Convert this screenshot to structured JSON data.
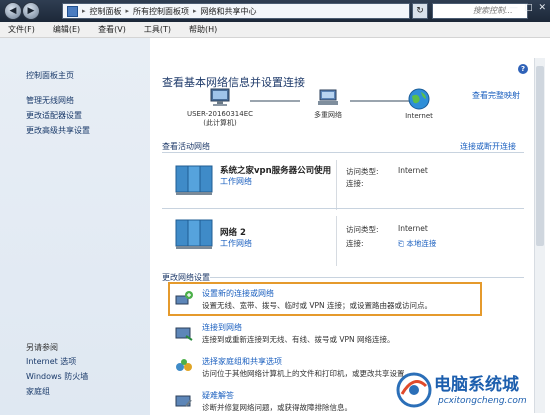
{
  "titlebar": {
    "back": "◀",
    "forward": "▶",
    "crumbs": [
      "控制面板",
      "所有控制面板项",
      "网络和共享中心"
    ],
    "refresh": "↻",
    "search_placeholder": "搜索控制...",
    "controls": [
      "—",
      "□",
      "✕"
    ]
  },
  "menu": [
    "文件(F)",
    "编辑(E)",
    "查看(V)",
    "工具(T)",
    "帮助(H)"
  ],
  "sidebar": {
    "home": "控制面板主页",
    "tasks": [
      "管理无线网络",
      "更改适配器设置",
      "更改高级共享设置"
    ],
    "see_also_title": "另请参阅",
    "see_also": [
      "Internet 选项",
      "Windows 防火墙",
      "家庭组"
    ]
  },
  "main": {
    "heading": "查看基本网络信息并设置连接",
    "full_map": "查看完整映射",
    "map_nodes": [
      {
        "label": "USER-20160314EC",
        "sub": "(此计算机)"
      },
      {
        "label": "多重网络",
        "sub": ""
      },
      {
        "label": "Internet",
        "sub": ""
      }
    ],
    "active_title": "查看活动网络",
    "connect_link": "连接或断开连接",
    "networks": [
      {
        "name": "系统之家vpn服务器公司使用",
        "type": "工作网络",
        "access_label": "访问类型:",
        "access_value": "Internet",
        "conn_label": "连接:",
        "conn_value": ""
      },
      {
        "name": "网络  2",
        "type": "工作网络",
        "access_label": "访问类型:",
        "access_value": "Internet",
        "conn_label": "连接:",
        "conn_value": "本地连接"
      }
    ],
    "change_title": "更改网络设置",
    "tasks": [
      {
        "title": "设置新的连接或网络",
        "desc": "设置无线、宽带、拨号、临时或 VPN 连接；或设置路由器或访问点。"
      },
      {
        "title": "连接到网络",
        "desc": "连接到或重新连接到无线、有线、拨号或 VPN 网络连接。"
      },
      {
        "title": "选择家庭组和共享选项",
        "desc": "访问位于其他网络计算机上的文件和打印机，或更改共享设置。"
      },
      {
        "title": "疑难解答",
        "desc": "诊断并修复网络问题，或获得故障排除信息。"
      }
    ]
  },
  "watermark": {
    "brand": "电脑系统城",
    "url": "pcxitongcheng.com"
  },
  "colors": {
    "accent_link": "#1a5fbf",
    "highlight": "#e59a2c",
    "titlebar": "#1c2838"
  }
}
